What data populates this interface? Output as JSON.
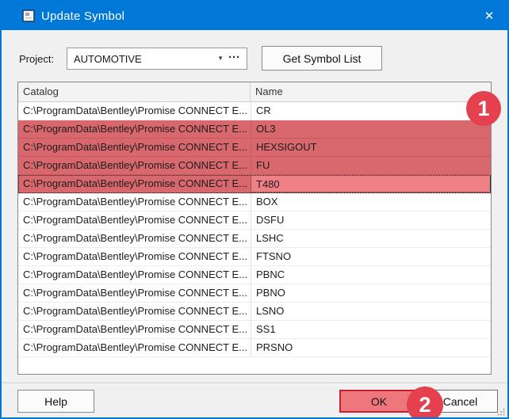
{
  "window": {
    "title": "Update Symbol",
    "close_icon": "✕"
  },
  "colors": {
    "titlebar_blue": "#0078d7",
    "annotation_red": "#e5404e",
    "row_highlight": "#d9686e",
    "focused_cell": "#ef8086",
    "ok_fill": "#ee777d",
    "ok_border": "#c81e2e"
  },
  "toolbar": {
    "project_label": "Project:",
    "project_value": "AUTOMOTIVE",
    "dropdown_icon": "▼",
    "browse_icon": "···",
    "get_symbol_list_label": "Get Symbol List"
  },
  "table": {
    "columns": [
      "Catalog",
      "Name"
    ],
    "catalog_path": "C:\\ProgramData\\Bentley\\Promise CONNECT E...",
    "rows": [
      {
        "name": "CR",
        "highlighted": false,
        "focused": false
      },
      {
        "name": "OL3",
        "highlighted": true,
        "focused": false
      },
      {
        "name": "HEXSIGOUT",
        "highlighted": true,
        "focused": false
      },
      {
        "name": "FU",
        "highlighted": true,
        "focused": false
      },
      {
        "name": "T480",
        "highlighted": true,
        "focused": true
      },
      {
        "name": "BOX",
        "highlighted": false,
        "focused": false
      },
      {
        "name": "DSFU",
        "highlighted": false,
        "focused": false
      },
      {
        "name": "LSHC",
        "highlighted": false,
        "focused": false
      },
      {
        "name": "FTSNO",
        "highlighted": false,
        "focused": false
      },
      {
        "name": "PBNC",
        "highlighted": false,
        "focused": false
      },
      {
        "name": "PBNO",
        "highlighted": false,
        "focused": false
      },
      {
        "name": "LSNO",
        "highlighted": false,
        "focused": false
      },
      {
        "name": "SS1",
        "highlighted": false,
        "focused": false
      },
      {
        "name": "PRSNO",
        "highlighted": false,
        "focused": false
      }
    ]
  },
  "annotations": [
    {
      "label": "1"
    },
    {
      "label": "2"
    }
  ],
  "footer": {
    "help_label": "Help",
    "ok_label": "OK",
    "cancel_label": "Cancel"
  }
}
